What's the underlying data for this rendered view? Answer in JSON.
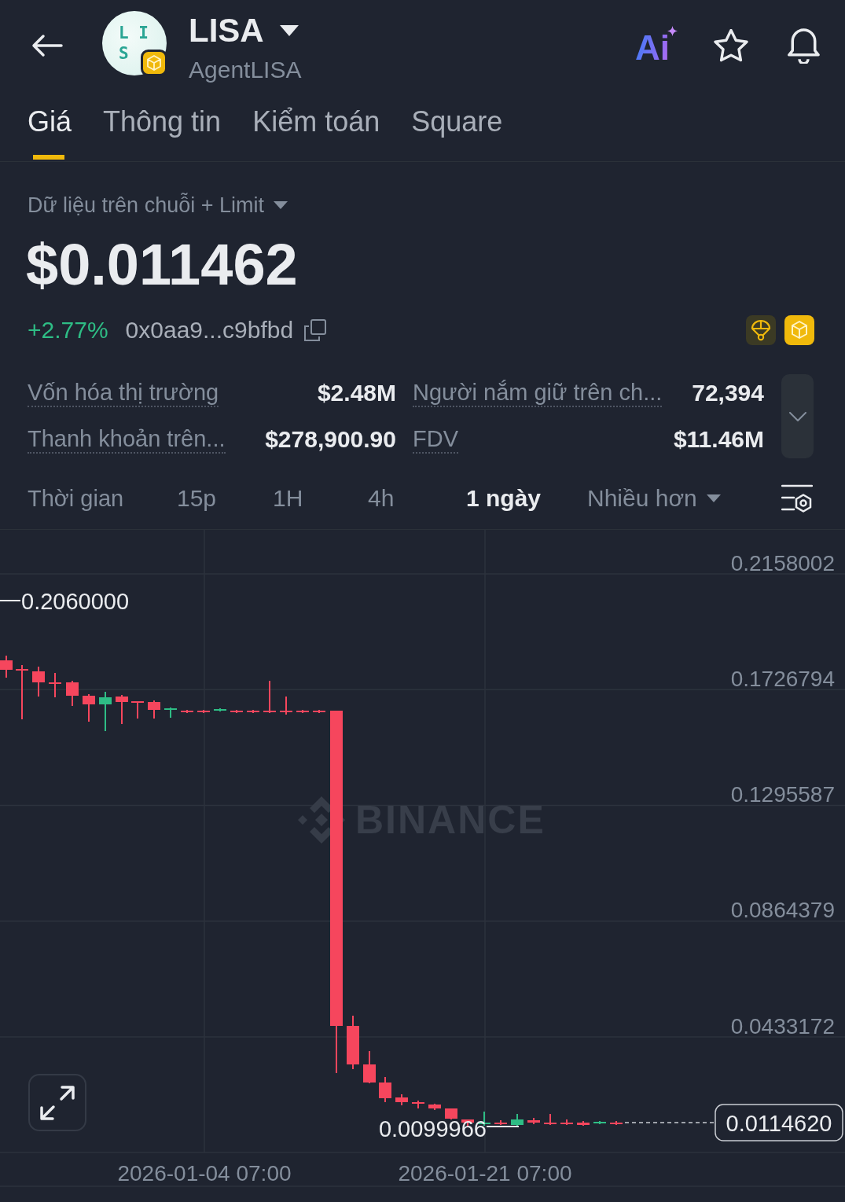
{
  "header": {
    "title": "LISA",
    "subtitle": "AgentLISA",
    "logo_lines": [
      "L I",
      "S"
    ],
    "ai_label": "Ai"
  },
  "tabs": [
    {
      "label": "Giá",
      "selected": true
    },
    {
      "label": "Thông tin",
      "selected": false
    },
    {
      "label": "Kiểm toán",
      "selected": false
    },
    {
      "label": "Square",
      "selected": false
    }
  ],
  "data_source": "Dữ liệu trên chuỗi + Limit",
  "price": "$0.011462",
  "change": {
    "text": "+2.77%",
    "rising": true
  },
  "contract": "0x0aa9...c9bfbd",
  "stats": [
    {
      "label": "Vốn hóa thị trường",
      "value": "$2.48M"
    },
    {
      "label": "Người nắm giữ trên ch...",
      "value": "72,394"
    },
    {
      "label": "Thanh khoản trên...",
      "value": "$278,900.90"
    },
    {
      "label": "FDV",
      "value": "$11.46M"
    }
  ],
  "intervals": {
    "label": "Thời gian",
    "options": [
      {
        "label": "15p",
        "selected": false
      },
      {
        "label": "1H",
        "selected": false
      },
      {
        "label": "4h",
        "selected": false
      },
      {
        "label": "1 ngày",
        "selected": true
      }
    ],
    "more": "Nhiều hơn"
  },
  "chart": {
    "y_axis": [
      "0.2158002",
      "0.1726794",
      "0.1295587",
      "0.0864379",
      "0.0433172"
    ],
    "x_axis": [
      "2026-01-04 07:00",
      "2026-01-21 07:00"
    ],
    "high_marker": "0.2060000",
    "low_marker": "0.0099966",
    "last_price": "0.0114620",
    "watermark": "BINANCE"
  }
}
